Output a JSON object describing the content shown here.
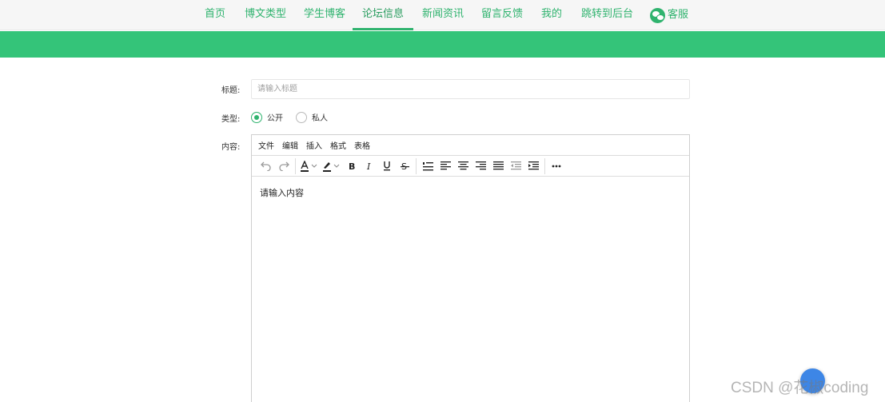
{
  "nav": {
    "items": [
      {
        "label": "首页"
      },
      {
        "label": "博文类型"
      },
      {
        "label": "学生博客"
      },
      {
        "label": "论坛信息",
        "active": true
      },
      {
        "label": "新闻资讯"
      },
      {
        "label": "留言反馈"
      },
      {
        "label": "我的"
      },
      {
        "label": "跳转到后台"
      }
    ],
    "service": {
      "label": "客服",
      "icon": "wechat-icon"
    }
  },
  "form": {
    "title_label": "标题:",
    "title_placeholder": "请输入标题",
    "type_label": "类型:",
    "type_options": [
      {
        "label": "公开",
        "checked": true
      },
      {
        "label": "私人",
        "checked": false
      }
    ],
    "content_label": "内容:"
  },
  "editor": {
    "menus": [
      "文件",
      "编辑",
      "插入",
      "格式",
      "表格"
    ],
    "content": "请输入内容",
    "toolbar_icons": [
      "undo-icon",
      "redo-icon",
      "text-color-icon",
      "highlight-color-icon",
      "bold-icon",
      "italic-icon",
      "underline-icon",
      "strikethrough-icon",
      "ordered-list-icon",
      "align-left-icon",
      "align-center-icon",
      "align-right-icon",
      "justify-icon",
      "outdent-icon",
      "indent-icon",
      "more-icon"
    ]
  },
  "watermark": "CSDN @花椒coding",
  "colors": {
    "accent": "#2fb36e",
    "band": "#34c479"
  }
}
